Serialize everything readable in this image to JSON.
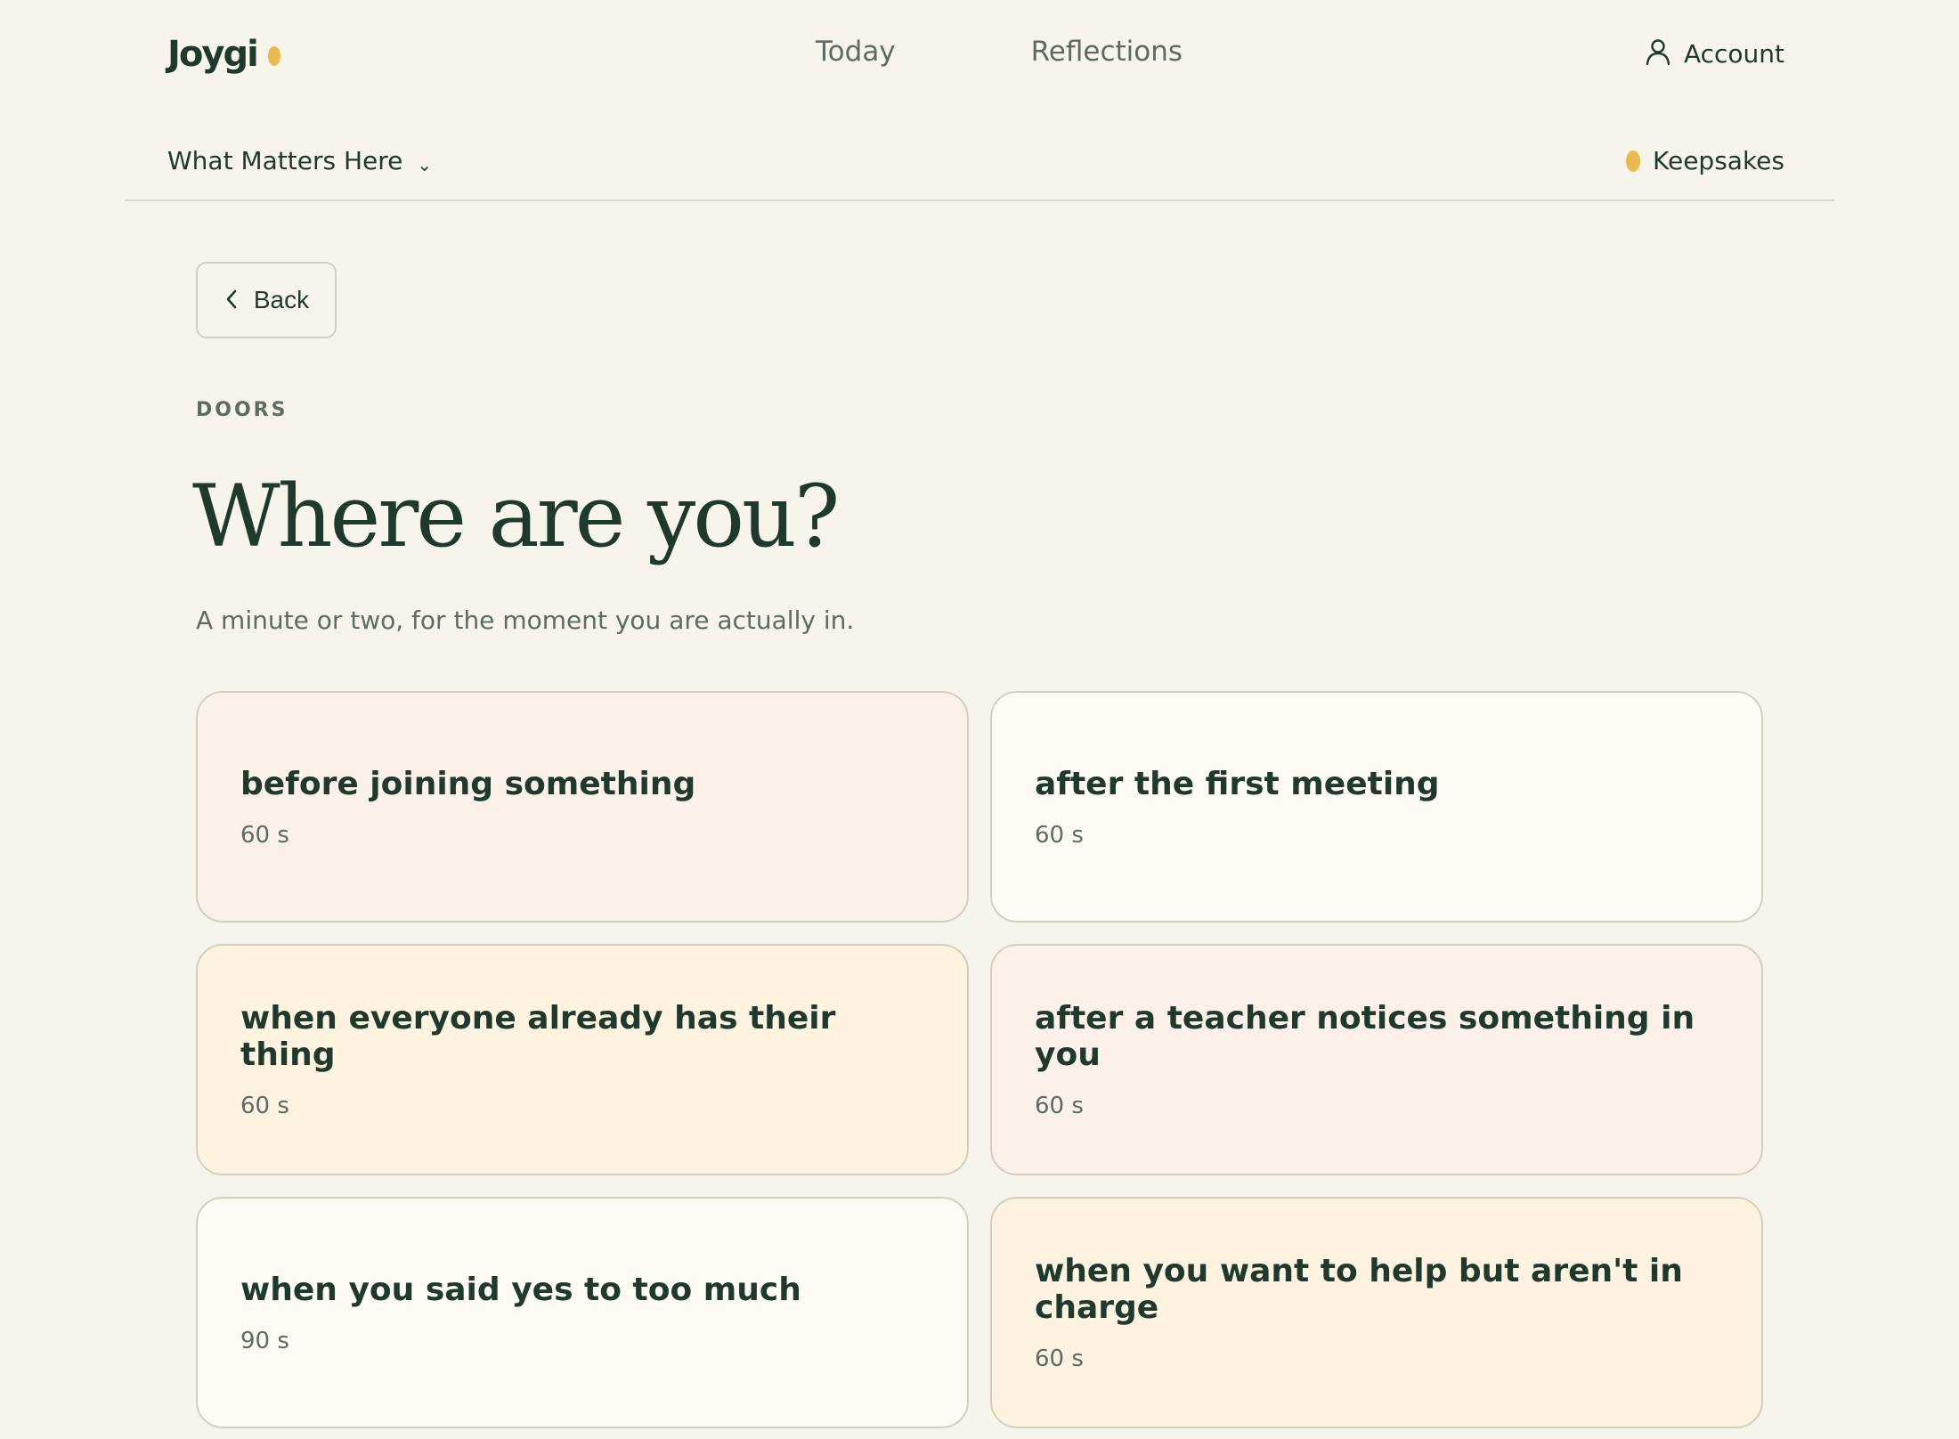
{
  "header": {
    "logo": "Joygi",
    "nav": [
      {
        "label": "Today"
      },
      {
        "label": "Reflections"
      }
    ],
    "account_label": "Account"
  },
  "subbar": {
    "section_label": "What Matters Here",
    "keepsakes_label": "Keepsakes"
  },
  "main": {
    "back_label": "Back",
    "eyebrow": "DOORS",
    "title": "Where are you?",
    "subtitle": "A minute or two, for the moment you are actually in.",
    "cards": [
      {
        "title": "before joining something",
        "duration": "60 s"
      },
      {
        "title": "after the first meeting",
        "duration": "60 s"
      },
      {
        "title": "when everyone already has their thing",
        "duration": "60 s"
      },
      {
        "title": "after a teacher notices something in you",
        "duration": "60 s"
      },
      {
        "title": "when you said yes to too much",
        "duration": "90 s"
      },
      {
        "title": "when you want to help but aren't in charge",
        "duration": "60 s"
      }
    ]
  },
  "colors": {
    "background": "#f7f4ec",
    "text_primary": "#1f3a2c",
    "text_muted": "#5d6b63",
    "accent_dot": "#e9bb4f",
    "card_peach": "#fcf1e8",
    "card_cream": "#fefbf4",
    "card_butter": "#fdf3e0",
    "border": "#d4cfbf"
  },
  "icons": {
    "account": "user-icon",
    "section_toggle": "chevron-down-icon",
    "back": "chevron-left-icon",
    "logo_mark": "dot-icon",
    "keepsakes": "dot-icon"
  }
}
